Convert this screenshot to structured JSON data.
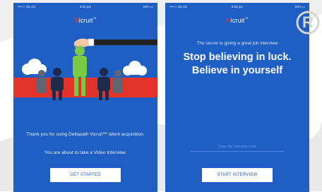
{
  "colors": {
    "screen_bg": "#1f5fc4",
    "accent_red": "#e2322a",
    "figure_green": "#7ac943",
    "figure_navy": "#1d2a4a",
    "figure_gray": "#5f6672",
    "cloud": "#ffffff",
    "button_bg": "#ffffff",
    "button_text": "#1f5fc4"
  },
  "left_screen": {
    "status_bar": {
      "carrier": "•••○○ Vip  4G",
      "time": "8:50 pm",
      "battery": "50% ▭"
    },
    "logo": {
      "accent": "V",
      "text": "icruit",
      "mark": "™"
    },
    "hero_icon": "hand-lifting-candidate-illustration",
    "message_thanks": "Thank you for using Deltapath Vicruit™ talent acquisition.",
    "message_about": "You are about to take a Video Interview.",
    "get_started_label": "GET STARTED"
  },
  "right_screen": {
    "status_bar": {
      "carrier": "•••○○ Vip  4G",
      "time": "8:50 pm",
      "battery": "50% ▭"
    },
    "logo": {
      "accent": "V",
      "text": "icruit",
      "mark": "™"
    },
    "tagline": "The secret to giving a great job interview",
    "quote": "Stop believing in luck. Believe in yourself",
    "name_placeholder": "Enter the interview code",
    "start_interview_label": "START INTERVIEW"
  },
  "watermark": {
    "letter": "R"
  }
}
